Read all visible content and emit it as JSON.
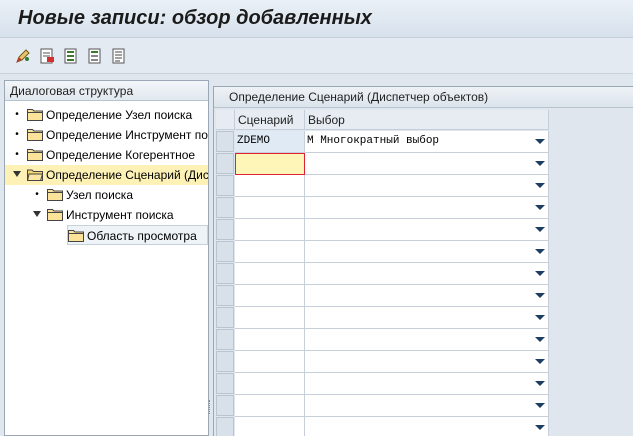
{
  "window": {
    "title": "Новые записи: обзор добавленных"
  },
  "toolbar": {
    "buttons": [
      "edit-pencil-icon",
      "delete-row-icon",
      "select-all-icon",
      "deselect-icon",
      "details-icon"
    ]
  },
  "tree": {
    "header": "Диалоговая структура",
    "items": [
      {
        "label": "Определение Узел поиска",
        "marker": "bullet",
        "level": 0
      },
      {
        "label": "Определение Инструмент поиска",
        "marker": "bullet",
        "level": 0
      },
      {
        "label": "Определение Когерентное",
        "marker": "bullet",
        "level": 0
      },
      {
        "label": "Определение Сценарий (Диспетчер объектов)",
        "marker": "expanded",
        "level": 0,
        "selected": true,
        "open_folder": true
      },
      {
        "label": "Узел поиска",
        "marker": "bullet",
        "level": 1
      },
      {
        "label": "Инструмент поиска",
        "marker": "expanded",
        "level": 1
      },
      {
        "label": "Область просмотра",
        "marker": "bullet",
        "level": 2,
        "highlight": true
      }
    ]
  },
  "table": {
    "title": "Определение Сценарий (Диспетчер объектов)",
    "columns": [
      "Сценарий",
      "Выбор"
    ],
    "rows": [
      {
        "scenario": "ZDEMO",
        "choice": "M Многократный выбор"
      },
      {
        "scenario": "",
        "choice": ""
      },
      {
        "scenario": "",
        "choice": ""
      },
      {
        "scenario": "",
        "choice": ""
      },
      {
        "scenario": "",
        "choice": ""
      },
      {
        "scenario": "",
        "choice": ""
      },
      {
        "scenario": "",
        "choice": ""
      },
      {
        "scenario": "",
        "choice": ""
      },
      {
        "scenario": "",
        "choice": ""
      },
      {
        "scenario": "",
        "choice": ""
      },
      {
        "scenario": "",
        "choice": ""
      },
      {
        "scenario": "",
        "choice": ""
      },
      {
        "scenario": "",
        "choice": ""
      },
      {
        "scenario": "",
        "choice": ""
      }
    ]
  },
  "colors": {
    "selected_row": "#fdf1b6",
    "focus_border": "#dd2233",
    "key_cell": "#dfeaf4"
  }
}
